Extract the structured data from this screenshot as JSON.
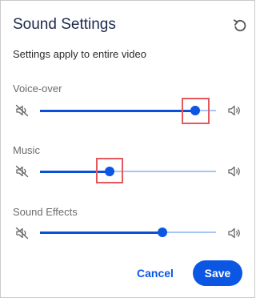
{
  "dialog": {
    "title": "Sound Settings",
    "subtitle": "Settings apply to entire video",
    "reset_icon": "undo-icon"
  },
  "sliders": [
    {
      "label": "Voice-over",
      "level_fraction": 0.88,
      "highlighted": true
    },
    {
      "label": "Music",
      "level_fraction": 0.395,
      "highlighted": true
    },
    {
      "label": "Sound Effects",
      "level_fraction": 0.695,
      "highlighted": false
    }
  ],
  "icons": {
    "mute": "speaker-muted-icon",
    "volume": "speaker-volume-icon"
  },
  "actions": {
    "cancel_label": "Cancel",
    "save_label": "Save"
  },
  "colors": {
    "accent": "#0b57e3",
    "title_text": "#1d2a4a",
    "track_inactive": "#a9c4f7",
    "highlight": "#e5595c"
  }
}
